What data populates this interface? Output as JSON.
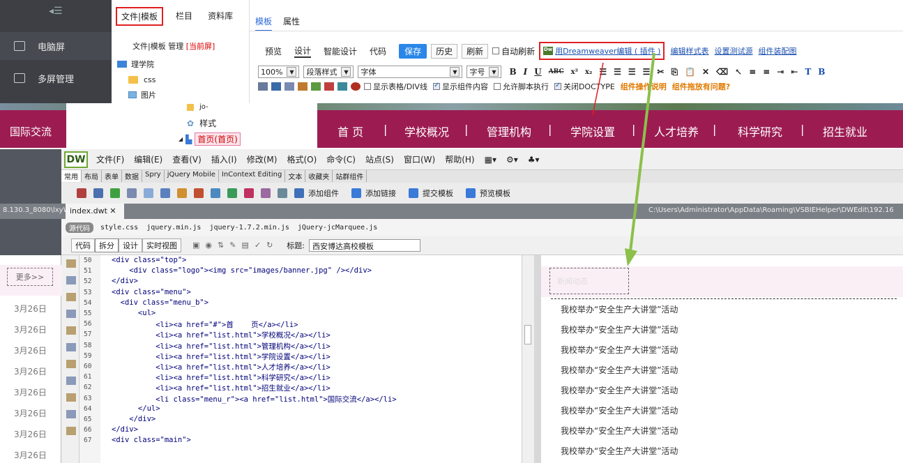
{
  "left_panel": {
    "items": [
      {
        "label": "电脑屏"
      },
      {
        "label": "多屏管理"
      }
    ]
  },
  "tree_panel": {
    "tabs": [
      "文件|模板",
      "栏目",
      "资料库"
    ],
    "subtitle": "文件|模板 管理",
    "subtitle_current": "[当前屏]",
    "items": [
      "理学院",
      "css",
      "图片"
    ]
  },
  "template_panel": {
    "tabs": [
      "模板",
      "属性"
    ],
    "toolbar1": {
      "preview": "预览",
      "design": "设计",
      "smart": "智能设计",
      "code": "代码",
      "save": "保存",
      "history": "历史",
      "refresh": "刷新",
      "autorefresh": "自动刷新",
      "dw_link": "用Dreamweaver编辑 ( 插件 )",
      "edit_css": "编辑样式表",
      "set_test": "设置测试源",
      "component": "组件装配图"
    },
    "toolbar2": {
      "zoom": "100%",
      "para": "段落样式",
      "font": "字体",
      "size": "字号"
    },
    "toolbar3": {
      "show_table": "显示表格/DIV线",
      "show_comp": "显示组件内容",
      "allow_script": "允许脚本执行",
      "close_doctype": "关闭DOCTYPE",
      "comp_help": "组件操作说明",
      "comp_drag": "组件拖放有问题?"
    }
  },
  "navbar": {
    "left": "国际交流",
    "tree_items": [
      "jo-",
      "样式",
      "首页(首页)"
    ],
    "items": [
      "首 页",
      "学校概况",
      "管理机构",
      "学院设置",
      "人才培养",
      "科学研究",
      "招生就业"
    ]
  },
  "dreamweaver": {
    "logo": "DW",
    "menu": [
      "文件(F)",
      "编辑(E)",
      "查看(V)",
      "插入(I)",
      "修改(M)",
      "格式(O)",
      "命令(C)",
      "站点(S)",
      "窗口(W)",
      "帮助(H)"
    ],
    "insert_tabs": [
      "常用",
      "布局",
      "表单",
      "数据",
      "Spry",
      "jQuery Mobile",
      "InContext Editing",
      "文本",
      "收藏夹",
      "站群组件"
    ],
    "icon_actions": [
      "添加组件",
      "添加链接",
      "提交模板",
      "预览模板"
    ],
    "left_path": "8.130.3_8080\\lxyW",
    "doc_tab": "index.dwt",
    "right_path": "C:\\Users\\Administrator\\AppData\\Roaming\\VSBIEHelper\\DWEdit\\192.16",
    "related_files": {
      "source": "源代码",
      "files": [
        "style.css",
        "jquery.min.js",
        "jquery-1.7.2.min.js",
        "jQuery-jcMarquee.js"
      ]
    },
    "view_buttons": [
      "代码",
      "拆分",
      "设计",
      "实时视图"
    ],
    "title_label": "标题:",
    "title_value": "西安博达高校模板"
  },
  "code": {
    "line_numbers": [
      "50",
      "51",
      "52",
      "53",
      "54",
      "55",
      "56",
      "57",
      "58",
      "59",
      "60",
      "61",
      "62",
      "63",
      "64",
      "65",
      "66",
      "67"
    ],
    "lines": [
      "<div class=\"top\">",
      "    <div class=\"logo\"><img src=\"images/banner.jpg\" /></div>",
      "</div>",
      "<div class=\"menu\">",
      "  <div class=\"menu_b\">",
      "      <ul>",
      "          <li><a href=\"#\">首    页</a></li>",
      "          <li><a href=\"list.html\">学校概况</a></li>",
      "          <li><a href=\"list.html\">管理机构</a></li>",
      "          <li><a href=\"list.html\">学院设置</a></li>",
      "          <li><a href=\"list.html\">人才培养</a></li>",
      "          <li><a href=\"list.html\">科学研究</a></li>",
      "          <li><a href=\"list.html\">招生就业</a></li>",
      "          <li class=\"menu_r\"><a href=\"list.html\">国际交流</a></li>",
      "      </ul>",
      "    </div>",
      "</div>",
      "<div class=\"main\">"
    ]
  },
  "left_preview": {
    "more": "更多>>",
    "dates": [
      "3月26日",
      "3月26日",
      "3月26日",
      "3月26日",
      "3月26日",
      "3月26日",
      "3月26日",
      "3月26日"
    ]
  },
  "design_view": {
    "box": "新闻动态",
    "items": [
      "我校举办“安全生产大讲堂”活动",
      "我校举办“安全生产大讲堂”活动",
      "我校举办“安全生产大讲堂”活动",
      "我校举办“安全生产大讲堂”活动",
      "我校举办“安全生产大讲堂”活动",
      "我校举办“安全生产大讲堂”活动",
      "我校举办“安全生产大讲堂”活动",
      "我校举办“安全生产大讲堂”活动"
    ]
  },
  "colors": {
    "nav": "#9c1c52",
    "dw_green": "#6fa832",
    "highlight": "#e02020",
    "arrow": "#8cc04a"
  }
}
